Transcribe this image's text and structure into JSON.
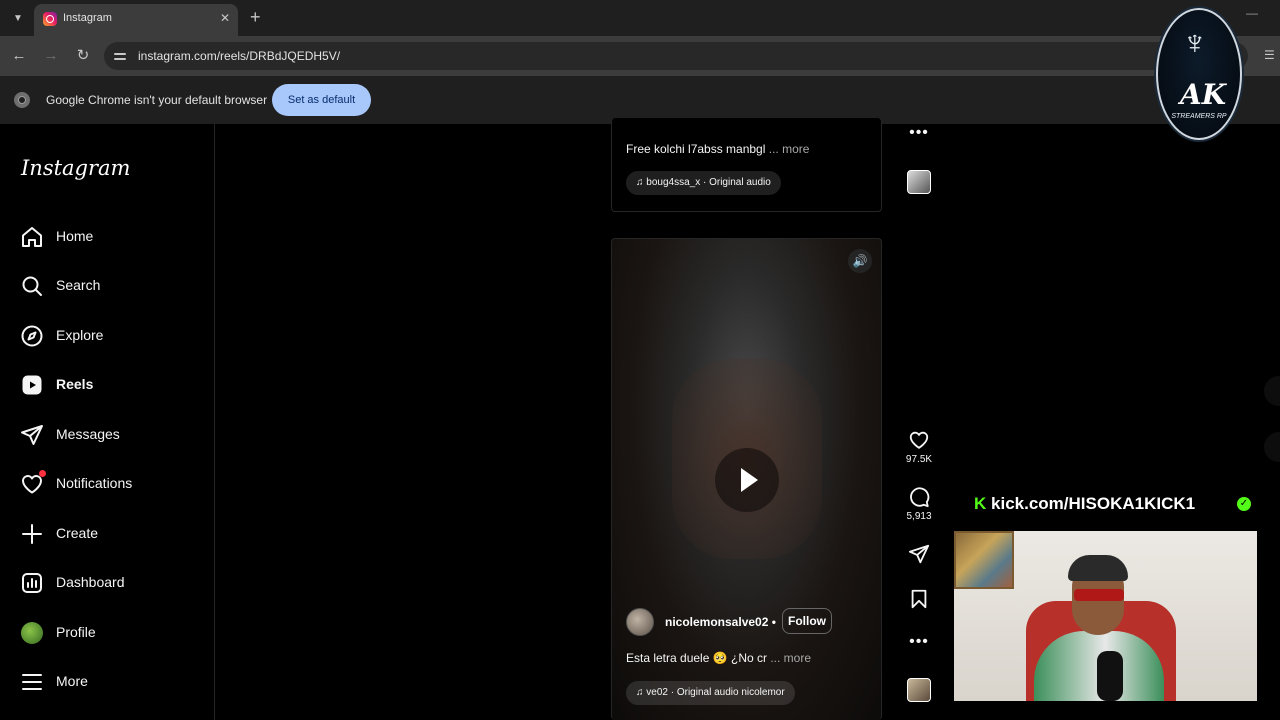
{
  "browser": {
    "tab_title": "Instagram",
    "url": "instagram.com/reels/DRBdJQEDH5V/",
    "infobar_text": "Google Chrome isn't your default browser",
    "set_default_label": "Set as default"
  },
  "sidebar": {
    "logo": "Instagram",
    "items": [
      {
        "label": "Home",
        "icon": "home-icon"
      },
      {
        "label": "Search",
        "icon": "search-icon"
      },
      {
        "label": "Explore",
        "icon": "compass-icon"
      },
      {
        "label": "Reels",
        "icon": "reels-icon",
        "active": true
      },
      {
        "label": "Messages",
        "icon": "messages-icon"
      },
      {
        "label": "Notifications",
        "icon": "heart-icon"
      },
      {
        "label": "Create",
        "icon": "plus-icon"
      },
      {
        "label": "Dashboard",
        "icon": "dashboard-icon"
      },
      {
        "label": "Profile",
        "icon": "avatar"
      },
      {
        "label": "More",
        "icon": "menu-icon"
      }
    ]
  },
  "reel_top": {
    "caption": "Free kolchi l7abss manbgl",
    "more": "... more",
    "audio": "boug4ssa_x · Original audio"
  },
  "reel_main": {
    "author": "nicolemonsalve02",
    "separator": "•",
    "follow": "Follow",
    "caption": "Esta letra duele 🥺 ¿No cr",
    "more": "... more",
    "audio": "ve02 · Original audio   nicolemor",
    "likes": "97.5K",
    "comments": "5,913"
  },
  "overlay": {
    "logo_text": "AK",
    "logo_sub": "STREAMERS RP",
    "kick_url": "kick.com/HISOKA1KICK1"
  },
  "colors": {
    "accent_button": "#a8c7fa",
    "notification_dot": "#ff3040",
    "kick_green": "#53fc18"
  }
}
